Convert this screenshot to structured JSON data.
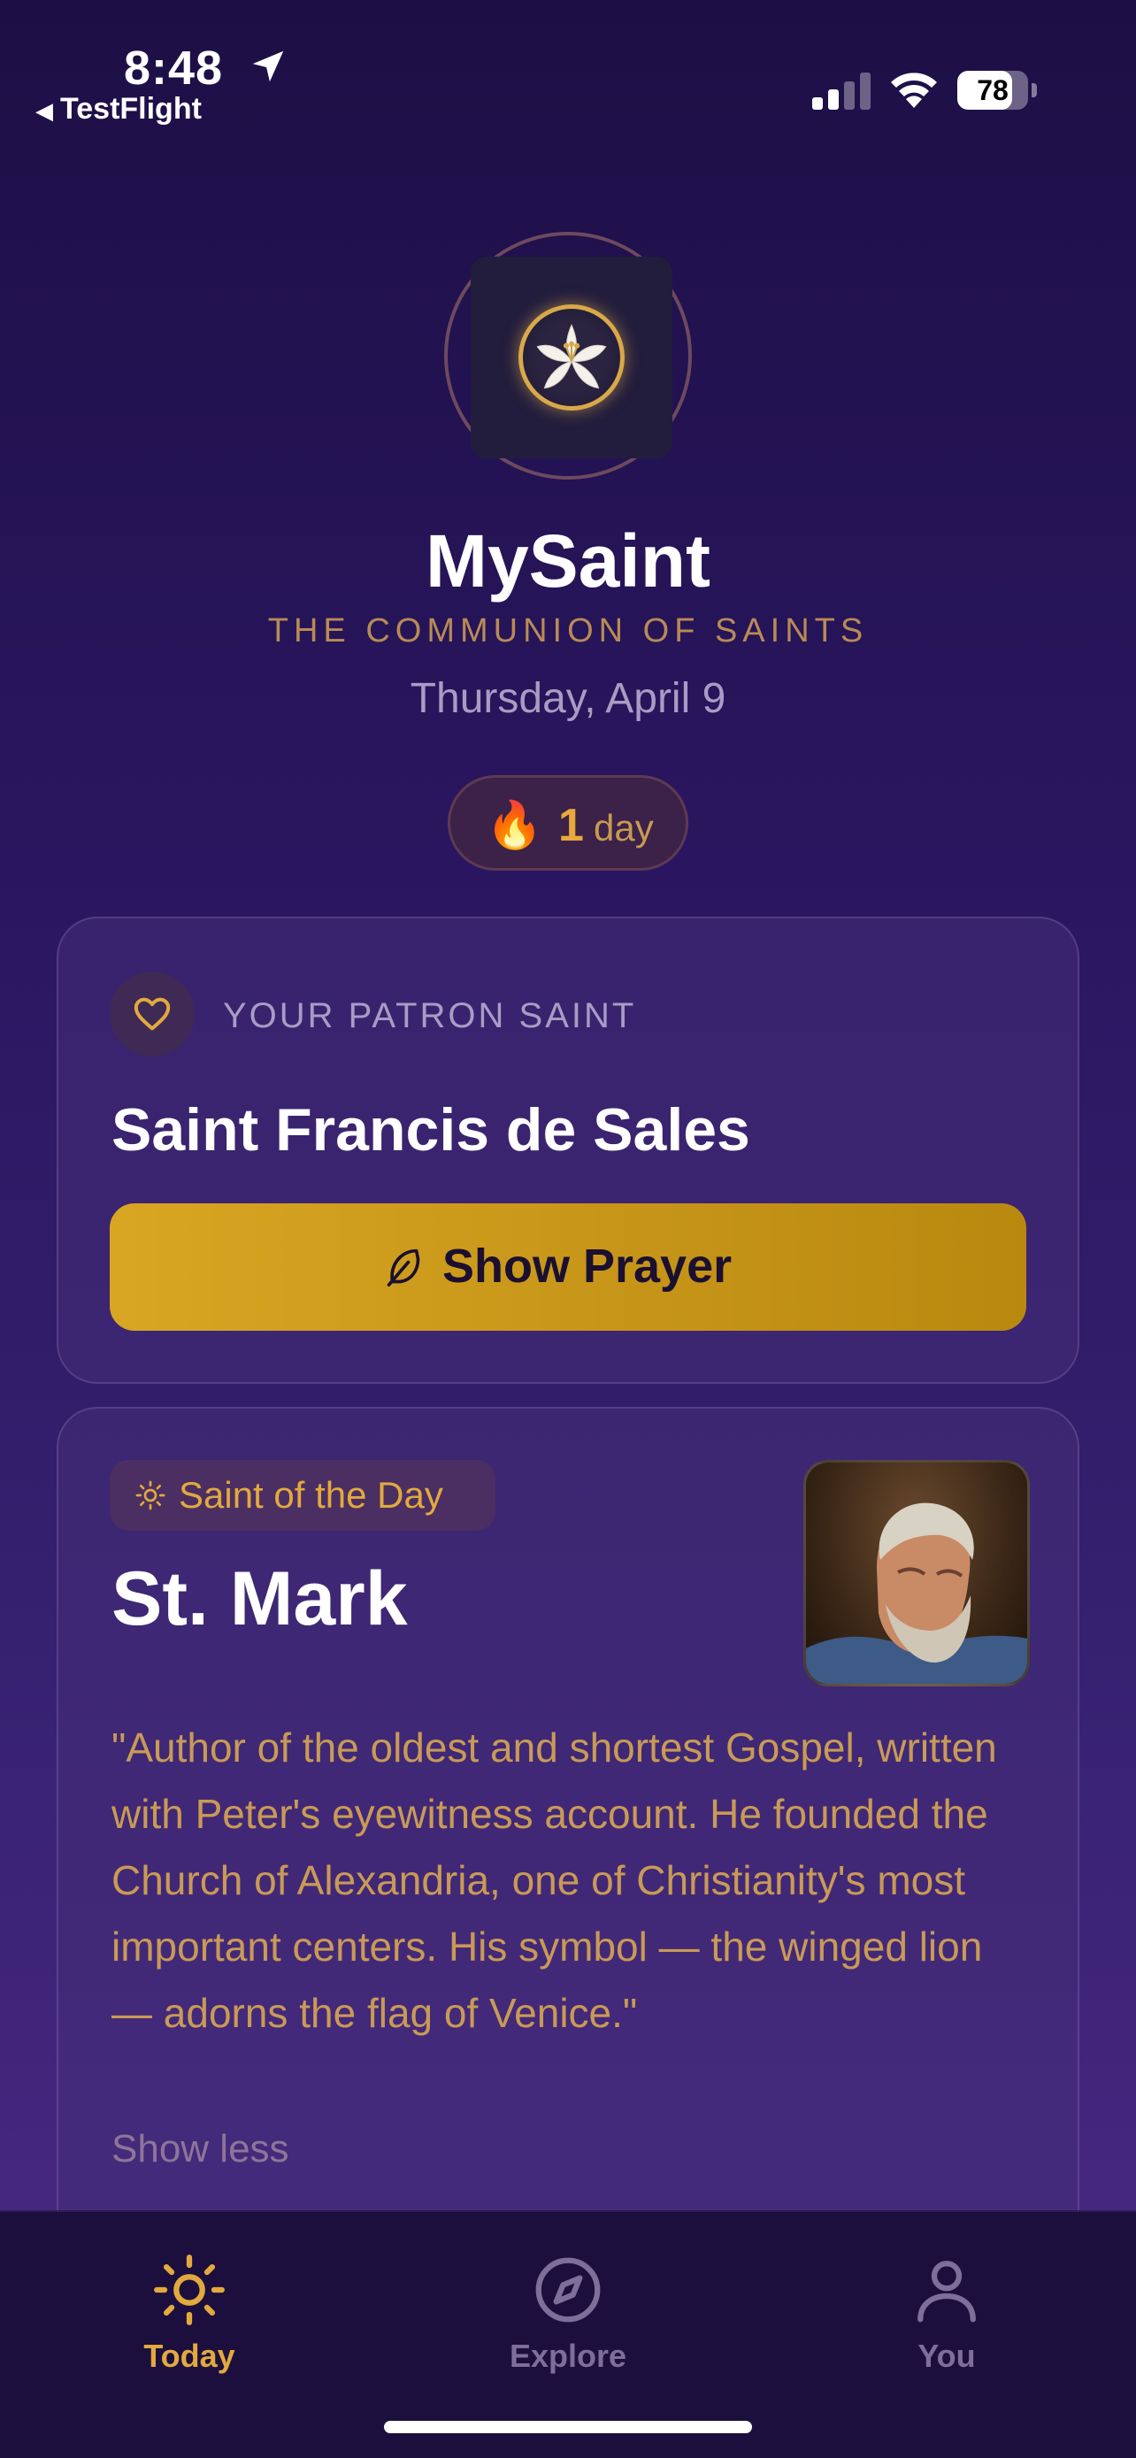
{
  "status_bar": {
    "time": "8:48",
    "back_app": "TestFlight",
    "battery_level": "78",
    "battery_fraction": 0.78
  },
  "header": {
    "app_name": "MySaint",
    "tagline": "THE COMMUNION OF SAINTS",
    "date": "Thursday, April 9",
    "streak_icon": "🔥",
    "streak_count": "1",
    "streak_unit": "day"
  },
  "patron": {
    "label": "YOUR PATRON SAINT",
    "name": "Saint Francis de Sales",
    "button_label": "Show Prayer"
  },
  "saint_of_day": {
    "badge_label": "Saint of the Day",
    "name": "St. Mark",
    "quote": "\"Author of the oldest and shortest Gospel, written with Peter's eyewitness account. He founded the Church of Alexandria, one of Christianity's most important centers. His symbol — the winged lion — adorns the flag of Venice.\"",
    "toggle_label": "Show less"
  },
  "tab_bar": {
    "items": [
      {
        "label": "Today",
        "icon": "sun-icon",
        "active": true
      },
      {
        "label": "Explore",
        "icon": "compass-icon",
        "active": false
      },
      {
        "label": "You",
        "icon": "person-icon",
        "active": false
      }
    ]
  },
  "colors": {
    "accent_gold": "#e2a93e",
    "button_gold": "#d9a622",
    "background": "#2a1660",
    "tab_active": "#e2a93e",
    "tab_inactive": "#7d6f9a"
  }
}
